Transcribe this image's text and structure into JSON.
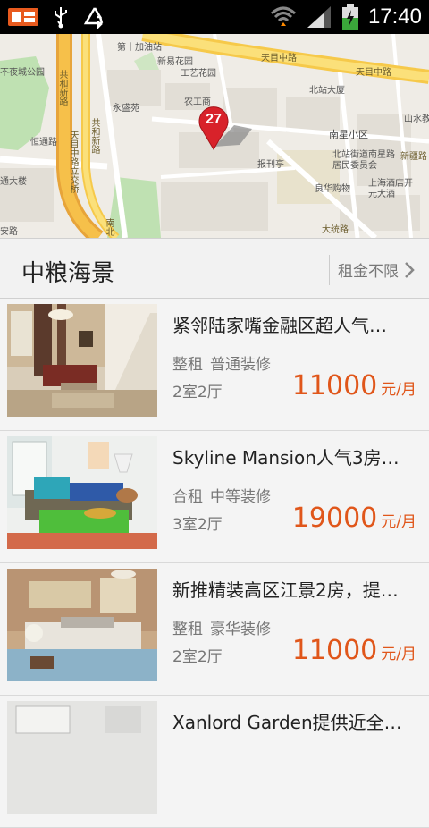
{
  "status": {
    "time": "17:40"
  },
  "map": {
    "marker_count": "27",
    "labels": {
      "gas_station": "第十加油站",
      "xinyi_garden": "新易花园",
      "buyeshan_park": "不夜城公园",
      "gongyi_garden": "工艺花园",
      "tianmu_mid_rd_top": "天目中路",
      "beizhan_building": "北站大厦",
      "yongsheng_yuan": "永盛苑",
      "nongjiang": "农工商",
      "nanxing_community": "南星小区",
      "gongheyi_rd": "共和新路",
      "hengtong_rd": "恒通路",
      "tianmu_overpass": "天目中路立交桥",
      "gonghe_xin_rd2": "共和新路",
      "tongda_building": "通大楼",
      "baoche_nan": "报刊亭",
      "beizhan_street": "北站街道南星路居民委员会",
      "liangshang": "良华购物",
      "shanghai_hotel": "上海酒店开元大酒",
      "new_road": "新疆路",
      "shanbei": "山水教",
      "datong_rd": "大统路",
      "nanbei": "南北",
      "xiaan": "安路",
      "tianmu_east": "天目中路"
    }
  },
  "header": {
    "title": "中粮海景",
    "filter_label": "租金不限"
  },
  "listings": [
    {
      "name": "紧邻陆家嘴金融区超人气…",
      "tag1": "整租",
      "tag2": "普通装修",
      "rooms": "2室2厅",
      "price": "11000",
      "unit": "元/月"
    },
    {
      "name": "Skyline Mansion人气3房…",
      "tag1": "合租",
      "tag2": "中等装修",
      "rooms": "3室2厅",
      "price": "19000",
      "unit": "元/月"
    },
    {
      "name": "新推精装高区江景2房，提…",
      "tag1": "整租",
      "tag2": "豪华装修",
      "rooms": "2室2厅",
      "price": "11000",
      "unit": "元/月"
    },
    {
      "name": "Xanlord Garden提供近全…",
      "tag1": "",
      "tag2": "",
      "rooms": "",
      "price": "",
      "unit": ""
    }
  ],
  "colors": {
    "accent": "#e0561a",
    "marker": "#d8222a"
  }
}
